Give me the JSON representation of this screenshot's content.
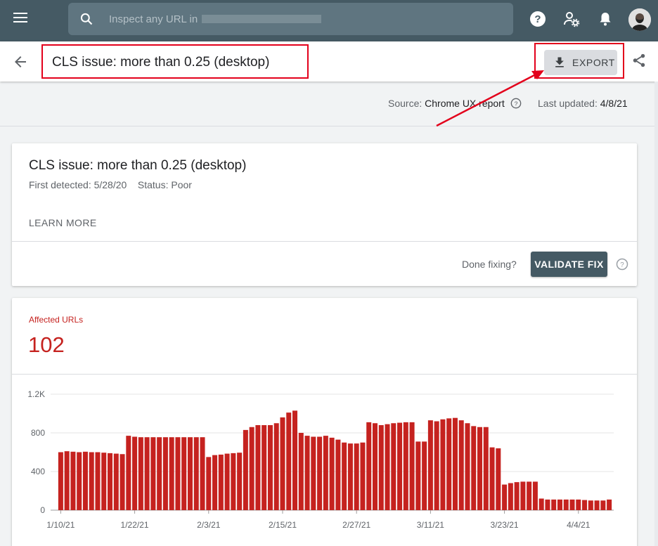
{
  "topbar": {
    "menu_icon": "hamburger-menu-icon",
    "search_placeholder": "Inspect any URL in",
    "icons": [
      "help-circle-icon",
      "account-settings-icon",
      "notifications-bell-icon"
    ],
    "avatar": "user-avatar"
  },
  "header": {
    "back_icon": "arrow-back-icon",
    "title": "CLS issue: more than 0.25 (desktop)",
    "export_label": "EXPORT",
    "export_icon": "download-icon",
    "share_icon": "share-icon"
  },
  "meta": {
    "source_label": "Source:",
    "source_value": "Chrome UX report",
    "updated_label": "Last updated:",
    "updated_value": "4/8/21"
  },
  "issue_card": {
    "title": "CLS issue: more than 0.25 (desktop)",
    "first_detected_label": "First detected:",
    "first_detected": "5/28/20",
    "status_label": "Status:",
    "status": "Poor",
    "learn_more": "LEARN MORE",
    "done_fixing": "Done fixing?",
    "validate_fix": "VALIDATE FIX"
  },
  "affected": {
    "label": "Affected URLs",
    "value": "102"
  },
  "colors": {
    "topbar": "#455a64",
    "accent_red": "#c5221f",
    "bar": "#c5221f",
    "annotation": "#e3001b"
  },
  "chart_data": {
    "type": "bar",
    "title": "",
    "xlabel": "",
    "ylabel": "",
    "ylim": [
      0,
      1200
    ],
    "yticks": [
      "0",
      "400",
      "800",
      "1.2K"
    ],
    "x_tick_labels": [
      "1/10/21",
      "1/22/21",
      "2/3/21",
      "2/15/21",
      "2/27/21",
      "3/11/21",
      "3/23/21",
      "4/4/21"
    ],
    "x_tick_index": [
      0,
      12,
      24,
      36,
      48,
      60,
      72,
      84
    ],
    "grid": true,
    "series": [
      {
        "values": [
          600,
          610,
          605,
          600,
          605,
          600,
          600,
          595,
          590,
          585,
          580,
          770,
          760,
          755,
          755,
          755,
          755,
          755,
          755,
          755,
          755,
          755,
          755,
          755,
          550,
          570,
          575,
          585,
          590,
          595,
          830,
          860,
          880,
          880,
          880,
          900,
          960,
          1010,
          1030,
          800,
          770,
          760,
          760,
          770,
          750,
          730,
          700,
          690,
          690,
          700,
          910,
          900,
          880,
          890,
          900,
          905,
          910,
          910,
          710,
          710,
          930,
          920,
          940,
          950,
          955,
          930,
          900,
          870,
          860,
          860,
          650,
          640,
          265,
          280,
          290,
          295,
          295,
          295,
          120,
          110,
          110,
          110,
          110,
          110,
          110,
          105,
          100,
          100,
          100,
          110
        ]
      }
    ]
  }
}
